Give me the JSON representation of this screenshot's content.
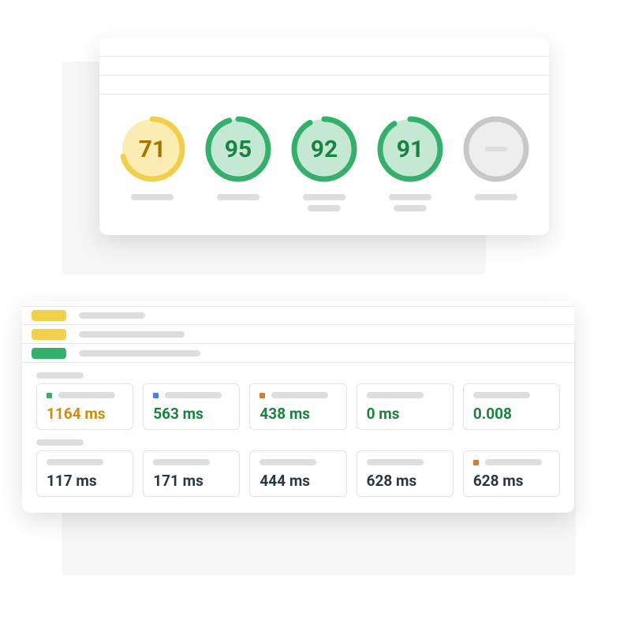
{
  "chart_data": [
    {
      "type": "radial-gauge",
      "label": "score1",
      "value": 71,
      "max": 100,
      "color": "yellow"
    },
    {
      "type": "radial-gauge",
      "label": "score2",
      "value": 95,
      "max": 100,
      "color": "green"
    },
    {
      "type": "radial-gauge",
      "label": "score3",
      "value": 92,
      "max": 100,
      "color": "green"
    },
    {
      "type": "radial-gauge",
      "label": "score4",
      "value": 91,
      "max": 100,
      "color": "green"
    },
    {
      "type": "radial-gauge",
      "label": "score5",
      "value": null,
      "max": 100,
      "color": "gray"
    }
  ],
  "scores": {
    "items": [
      {
        "value": "71",
        "pct": 71,
        "ring": "#f1cf4b",
        "track": "#fbecb3",
        "text": "#a37500"
      },
      {
        "value": "95",
        "pct": 95,
        "ring": "#34b06a",
        "track": "#c5e8d3",
        "text": "#18843f"
      },
      {
        "value": "92",
        "pct": 92,
        "ring": "#34b06a",
        "track": "#c5e8d3",
        "text": "#18843f"
      },
      {
        "value": "91",
        "pct": 91,
        "ring": "#34b06a",
        "track": "#c5e8d3",
        "text": "#18843f"
      },
      {
        "value": "",
        "pct": 0,
        "ring": "#c8c8c8",
        "track": "#eeeeee",
        "text": "#9e9e9e",
        "na": true
      }
    ]
  },
  "metrics": {
    "row1": [
      {
        "value": "1164 ms",
        "quality": "mid",
        "dot": "green"
      },
      {
        "value": "563 ms",
        "quality": "good",
        "dot": "blue"
      },
      {
        "value": "438 ms",
        "quality": "good",
        "dot": "orange"
      },
      {
        "value": "0 ms",
        "quality": "good",
        "dot": null
      },
      {
        "value": "0.008",
        "quality": "good",
        "dot": null
      }
    ],
    "row2": [
      {
        "value": "117 ms",
        "quality": "neutral",
        "dot": null
      },
      {
        "value": "171 ms",
        "quality": "neutral",
        "dot": null
      },
      {
        "value": "444 ms",
        "quality": "neutral",
        "dot": null
      },
      {
        "value": "628 ms",
        "quality": "neutral",
        "dot": null
      },
      {
        "value": "628 ms",
        "quality": "neutral",
        "dot": "orange"
      }
    ]
  }
}
